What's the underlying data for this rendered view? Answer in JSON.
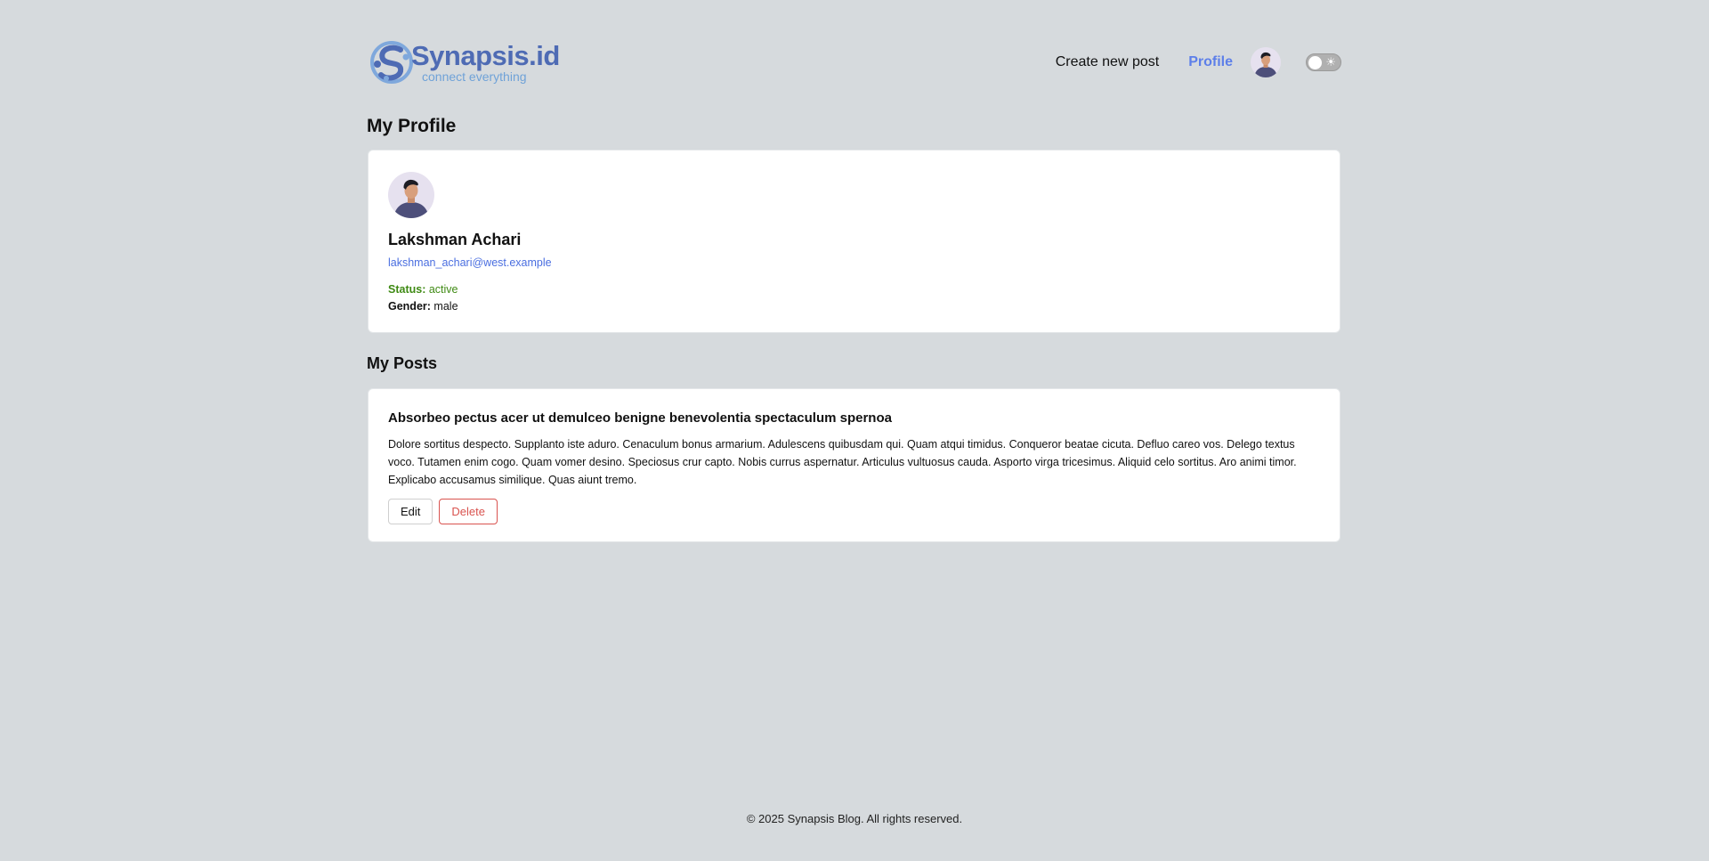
{
  "header": {
    "logo_name": "Synapsis.id",
    "logo_tagline": "connect everything",
    "nav": {
      "create_label": "Create new post",
      "profile_label": "Profile"
    },
    "theme_toggle": {
      "icon": "sun-icon",
      "state": "off"
    }
  },
  "profile_section": {
    "heading": "My Profile",
    "user": {
      "name": "Lakshman Achari",
      "email": "lakshman_achari@west.example",
      "status_label": "Status:",
      "status_value": "active",
      "gender_label": "Gender:",
      "gender_value": "male"
    }
  },
  "posts_section": {
    "heading": "My Posts",
    "posts": [
      {
        "title": "Absorbeo pectus acer ut demulceo benigne benevolentia spectaculum spernoa",
        "body": "Dolore sortitus despecto. Supplanto iste aduro. Cenaculum bonus armarium. Adulescens quibusdam qui. Quam atqui timidus. Conqueror beatae cicuta. Defluo careo vos. Delego textus voco. Tutamen enim cogo. Quam vomer desino. Speciosus crur capto. Nobis currus aspernatur. Articulus vultuosus cauda. Asporto virga tricesimus. Aliquid celo sortitus. Aro animi timor. Explicabo accusamus similique. Quas aiunt tremo.",
        "edit_label": "Edit",
        "delete_label": "Delete"
      }
    ]
  },
  "footer": {
    "text": "© 2025 Synapsis Blog. All rights reserved."
  },
  "colors": {
    "background": "#d6dadd",
    "accent": "#5d7fe9",
    "email": "#4a6ee0",
    "status_active": "#3f8a14",
    "danger": "#d9534f"
  }
}
